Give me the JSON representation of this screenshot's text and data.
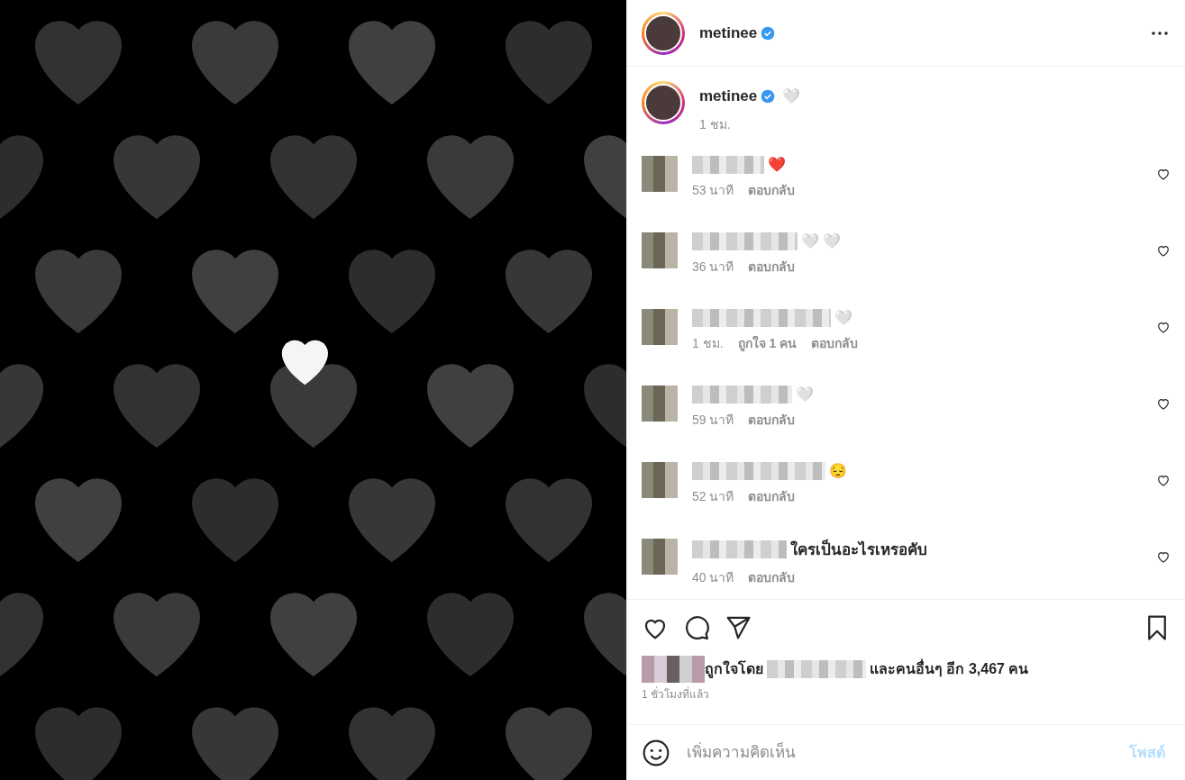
{
  "post": {
    "author": "metinee",
    "verified": true
  },
  "caption": {
    "author": "metinee",
    "verified": true,
    "emoji": [
      "🤍"
    ],
    "time": "1 ชม."
  },
  "comments": [
    {
      "emoji": [
        "❤️"
      ],
      "time": "53 นาที",
      "reply": "ตอบกลับ",
      "liked": false
    },
    {
      "emoji": [
        "🤍",
        "🤍"
      ],
      "time": "36 นาที",
      "reply": "ตอบกลับ",
      "liked": false
    },
    {
      "emoji": [
        "🤍"
      ],
      "time": "1 ชม.",
      "likes": "ถูกใจ 1 คน",
      "reply": "ตอบกลับ",
      "liked": false
    },
    {
      "emoji": [
        "🤍"
      ],
      "time": "59 นาที",
      "reply": "ตอบกลับ",
      "liked": false
    },
    {
      "emoji": [
        "😔"
      ],
      "time": "52 นาที",
      "reply": "ตอบกลับ",
      "liked": false
    },
    {
      "text": "ใครเป็นอะไรเหรอคับ",
      "time": "40 นาที",
      "reply": "ตอบกลับ",
      "liked": false
    }
  ],
  "actions": {
    "liked": false,
    "saved": false
  },
  "likes": {
    "prefix": "ถูกใจโดย",
    "suffix": "และคนอื่นๆ อีก 3,467 คน"
  },
  "posted": "1 ชั่วโมงที่แล้ว",
  "add_comment": {
    "placeholder": "เพิ่มความคิดเห็น",
    "button": "โพสต์",
    "disabled": true
  }
}
